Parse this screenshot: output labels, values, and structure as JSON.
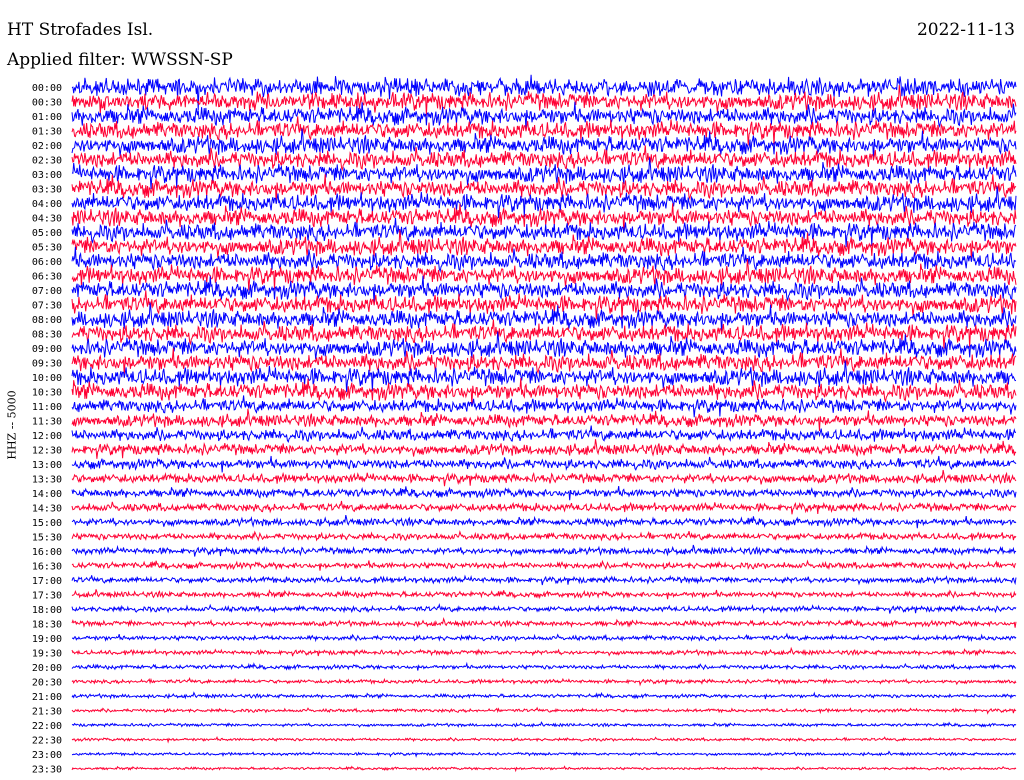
{
  "header": {
    "station": "HT Strofades Isl.",
    "date": "2022-11-13",
    "filter": "Applied filter: WWSSN-SP"
  },
  "chart_data": {
    "type": "line",
    "title": "HT Strofades Isl.",
    "subtitle": "Applied filter: WWSSN-SP",
    "ylabel": "HHZ -- 5000",
    "trace_colors": [
      "#0000ff",
      "#ff0033"
    ],
    "categories": [
      "00:00",
      "00:30",
      "01:00",
      "01:30",
      "02:00",
      "02:30",
      "03:00",
      "03:30",
      "04:00",
      "04:30",
      "05:00",
      "05:30",
      "06:00",
      "06:30",
      "07:00",
      "07:30",
      "08:00",
      "08:30",
      "09:00",
      "09:30",
      "10:00",
      "10:30",
      "11:00",
      "11:30",
      "12:00",
      "12:30",
      "13:00",
      "13:30",
      "14:00",
      "14:30",
      "15:00",
      "15:30",
      "16:00",
      "16:30",
      "17:00",
      "17:30",
      "18:00",
      "18:30",
      "19:00",
      "19:30",
      "20:00",
      "20:30",
      "21:00",
      "21:30",
      "22:00",
      "22:30",
      "23:00",
      "23:30"
    ],
    "amplitude": [
      1.0,
      1.0,
      1.0,
      1.0,
      1.0,
      1.0,
      1.0,
      1.0,
      1.0,
      1.0,
      1.0,
      1.0,
      1.0,
      1.0,
      1.0,
      1.0,
      1.0,
      1.0,
      1.0,
      1.0,
      1.0,
      0.95,
      0.9,
      0.85,
      0.8,
      0.75,
      0.68,
      0.62,
      0.58,
      0.55,
      0.5,
      0.46,
      0.44,
      0.42,
      0.4,
      0.38,
      0.36,
      0.34,
      0.32,
      0.3,
      0.28,
      0.26,
      0.24,
      0.22,
      0.2,
      0.19,
      0.18,
      0.17
    ],
    "grid": false,
    "legend": "none"
  }
}
